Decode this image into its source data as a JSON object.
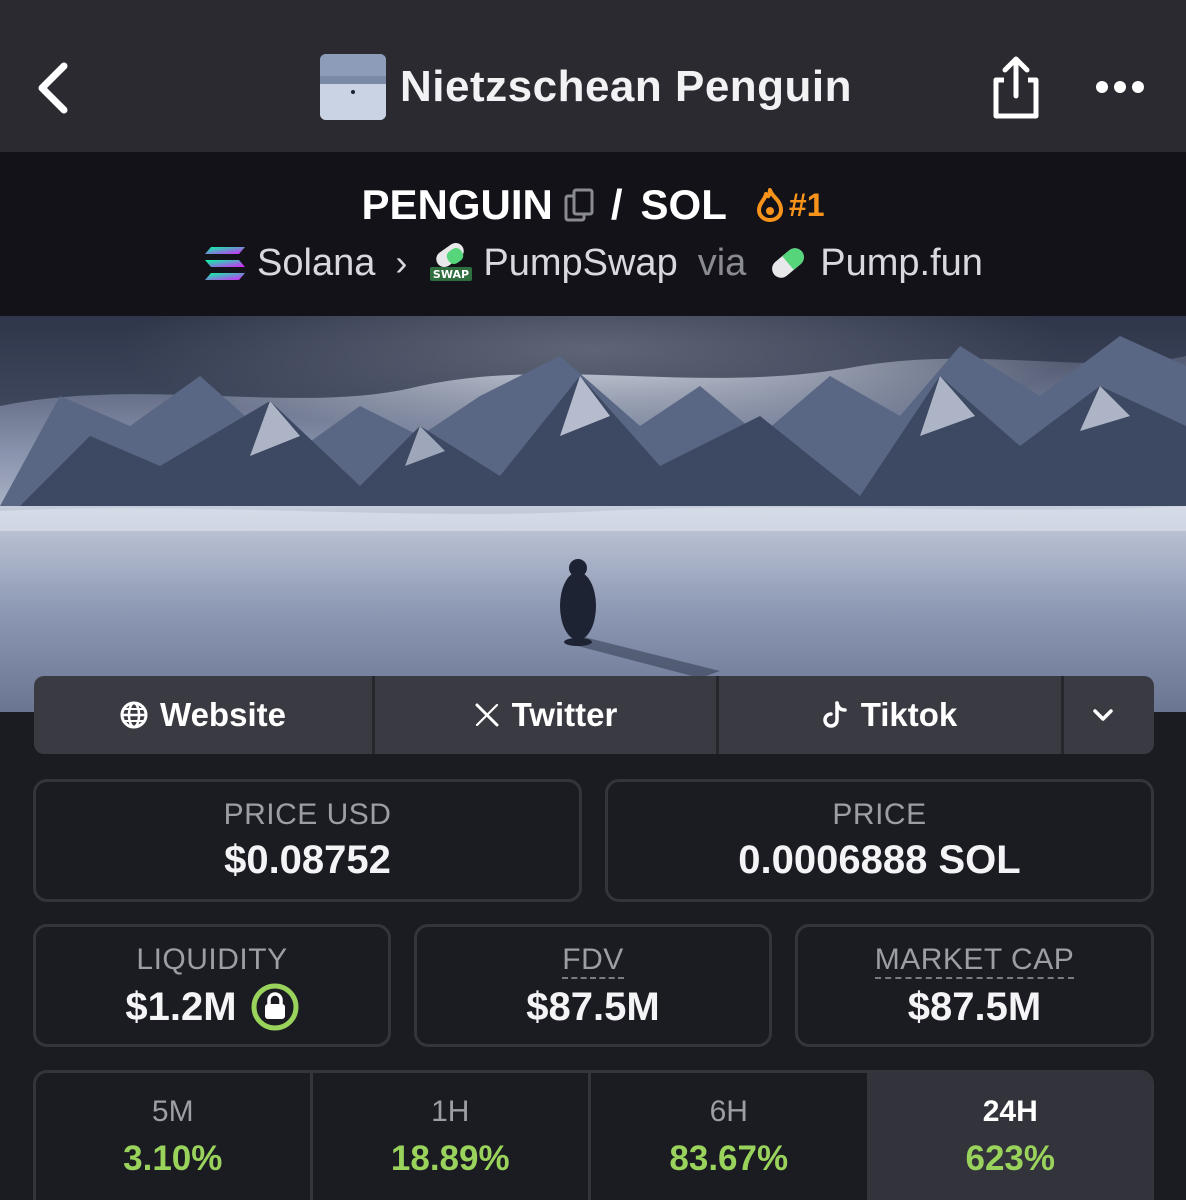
{
  "header": {
    "title": "Nietzschean Penguin"
  },
  "pair": {
    "base": "PENGUIN",
    "separator": "/",
    "quote": "SOL",
    "rank": "#1",
    "chain": "Solana",
    "dex": "PumpSwap",
    "via": "via",
    "launchpad": "Pump.fun",
    "swap_badge": "SWAP"
  },
  "links": {
    "website": "Website",
    "twitter": "Twitter",
    "tiktok": "Tiktok"
  },
  "stats": {
    "price_usd_label": "PRICE USD",
    "price_usd_value": "$0.08752",
    "price_label": "PRICE",
    "price_value": "0.0006888 SOL",
    "liquidity_label": "LIQUIDITY",
    "liquidity_value": "$1.2M",
    "fdv_label": "FDV",
    "fdv_value": "$87.5M",
    "mcap_label": "MARKET CAP",
    "mcap_value": "$87.5M"
  },
  "timeframes": [
    {
      "label": "5M",
      "value": "3.10%"
    },
    {
      "label": "1H",
      "value": "18.89%"
    },
    {
      "label": "6H",
      "value": "83.67%"
    },
    {
      "label": "24H",
      "value": "623%"
    }
  ],
  "colors": {
    "positive": "#9ad35c",
    "rank": "#f7931a",
    "lock": "#9ad35c"
  },
  "icons": [
    "back-icon",
    "share-icon",
    "more-icon",
    "copy-icon",
    "flame-icon",
    "solana-icon",
    "pumpswap-icon",
    "pill-icon",
    "globe-icon",
    "x-icon",
    "tiktok-icon",
    "chevron-down-icon",
    "lock-icon"
  ]
}
